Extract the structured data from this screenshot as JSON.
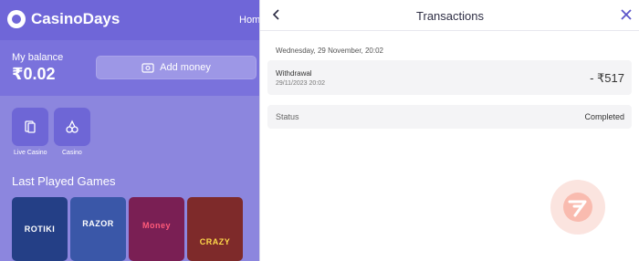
{
  "app": {
    "brand": "CasinoDays",
    "nav_link": "Home",
    "balance_label": "My balance",
    "balance_amount": "₹0.02",
    "add_money_label": "Add money",
    "categories": [
      {
        "label": "Live Casino",
        "icon": "cards-icon"
      },
      {
        "label": "Casino",
        "icon": "cherry-icon"
      }
    ],
    "last_played_title": "Last Played Games",
    "games": [
      {
        "name": "ROTIKI",
        "bg": "#243f86"
      },
      {
        "name": "RAZOR",
        "bg": "#3a57a8"
      },
      {
        "name": "Money",
        "bg": "#7a1f54"
      },
      {
        "name": "CRAZY",
        "bg": "#7e2a2a"
      }
    ],
    "colors": {
      "brand": "#6f66d8",
      "overlay": "#8c86de"
    }
  },
  "drawer": {
    "title": "Transactions",
    "date_heading": "Wednesday, 29 November, 20:02",
    "transaction": {
      "type": "Withdrawal",
      "datetime": "29/11/2023 20:02",
      "amount": "- ₹517"
    },
    "status": {
      "label": "Status",
      "value": "Completed"
    }
  }
}
